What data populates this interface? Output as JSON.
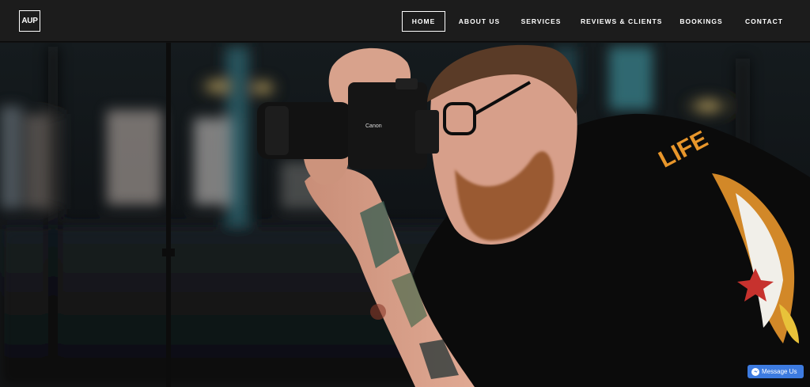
{
  "logo": {
    "text": "AUP"
  },
  "nav": {
    "items": [
      {
        "id": "home",
        "label": "HOME",
        "active": true
      },
      {
        "id": "about",
        "label": "ABOUT US"
      },
      {
        "id": "services",
        "label": "SERVICES"
      },
      {
        "id": "reviews",
        "label": "REVIEWS & CLIENTS"
      },
      {
        "id": "bookings",
        "label": "BOOKINGS"
      },
      {
        "id": "contact",
        "label": "CONTACT"
      }
    ]
  },
  "hero": {
    "image_subject": "photographer-with-camera",
    "shirt_print_text": "LIFE"
  },
  "messenger": {
    "label": "Message Us",
    "icon": "messenger-icon",
    "color": "#3d7be0"
  },
  "colors": {
    "header_bg": "#1c1c1c",
    "nav_text": "#ffffff",
    "accent_orange": "#e8962b"
  }
}
